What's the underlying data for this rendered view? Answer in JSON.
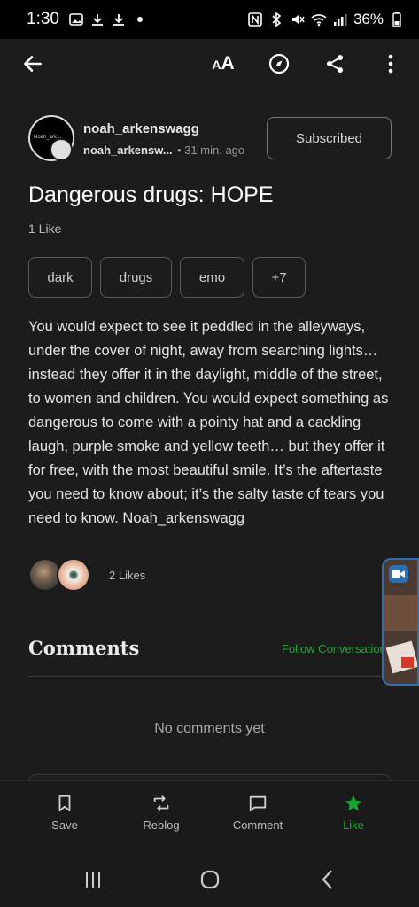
{
  "status_bar": {
    "time": "1:30",
    "battery": "36%",
    "left_icons": [
      "image-icon",
      "download-icon",
      "download-icon",
      "dot-icon"
    ],
    "right_icons": [
      "nfc-icon",
      "bluetooth-icon",
      "mute-icon",
      "wifi-icon",
      "signal-icon",
      "battery-icon"
    ]
  },
  "toolbar": {
    "back_icon": "arrow-left-icon",
    "text_size_label": "AA",
    "compass_icon": "compass-icon",
    "share_icon": "share-icon",
    "more_icon": "more-vertical-icon"
  },
  "author": {
    "name": "noah_arkenswagg",
    "handle": "noah_arkensw...",
    "time": "• 31 min. ago",
    "avatar_text": "Noah_ark...",
    "subscribe_label": "Subscribed"
  },
  "post": {
    "title": "Dangerous drugs: HOPE",
    "likes_line": "1 Like",
    "tags": [
      "dark",
      "drugs",
      "emo",
      "+7"
    ],
    "body": "You would expect to see it peddled in the alleyways, under the cover of night, away from searching lights… instead they offer it in the daylight, middle of the street, to women and children. You would expect something as dangerous to come with a pointy hat and a cackling laugh, purple smoke and yellow teeth… but they offer it for free, with the most beautiful smile. It’s the aftertaste you need to know about; it’s the salty taste of tears you need to know. Noah_arkenswagg",
    "likes_count": "2 Likes"
  },
  "comments": {
    "heading": "Comments",
    "follow_label": "Follow Conversation",
    "empty_text": "No comments yet"
  },
  "actions": {
    "save": "Save",
    "reblog": "Reblog",
    "comment": "Comment",
    "like": "Like"
  },
  "colors": {
    "accent_green": "#19a531",
    "background": "#1c1c1c"
  }
}
